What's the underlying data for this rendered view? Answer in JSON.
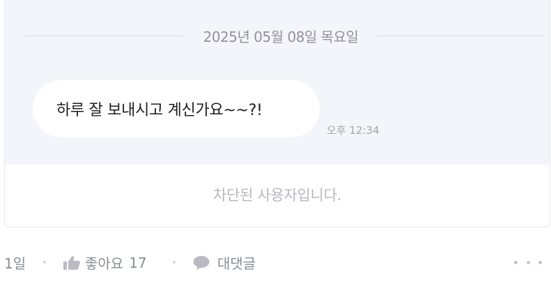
{
  "chat": {
    "date_divider": "2025년 05월 08일 목요일",
    "message": {
      "text": "하루 잘 보내시고 계신가요~~?!",
      "time": "오후 12:34"
    },
    "blocked_notice": "차단된 사용자입니다."
  },
  "footer": {
    "age": "1일",
    "like": {
      "icon": "thumbs-up-icon",
      "label": "좋아요",
      "count": "17"
    },
    "reply": {
      "icon": "speech-bubble-icon",
      "label": "대댓글"
    },
    "more": {
      "icon": "more-horizontal-icon"
    }
  },
  "colors": {
    "chat_background": "#f4f5fa",
    "bubble_background": "#ffffff",
    "muted_text": "#8a8d96",
    "icon_color": "#b9bbc2"
  }
}
